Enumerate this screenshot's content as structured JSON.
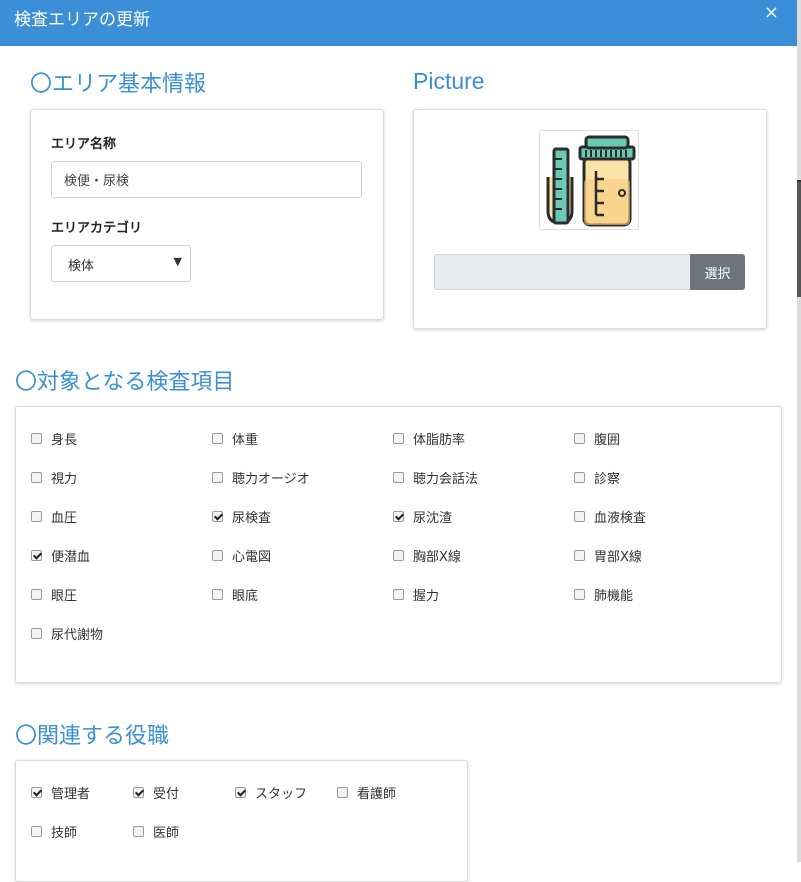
{
  "header": {
    "title": "検査エリアの更新",
    "close_label": "×"
  },
  "area_info": {
    "section_title": "〇エリア基本情報",
    "name_label": "エリア名称",
    "name_value": "検便・尿検",
    "category_label": "エリアカテゴリ",
    "category_value": "検体"
  },
  "picture": {
    "section_title": "Picture",
    "select_button": "選択"
  },
  "exam_items": {
    "section_title": "〇対象となる検査項目",
    "items": [
      {
        "label": "身長",
        "checked": false
      },
      {
        "label": "体重",
        "checked": false
      },
      {
        "label": "体脂肪率",
        "checked": false
      },
      {
        "label": "腹囲",
        "checked": false
      },
      {
        "label": "視力",
        "checked": false
      },
      {
        "label": "聴力オージオ",
        "checked": false
      },
      {
        "label": "聴力会話法",
        "checked": false
      },
      {
        "label": "診察",
        "checked": false
      },
      {
        "label": "血圧",
        "checked": false
      },
      {
        "label": "尿検査",
        "checked": true
      },
      {
        "label": "尿沈渣",
        "checked": true
      },
      {
        "label": "血液検査",
        "checked": false
      },
      {
        "label": "便潜血",
        "checked": true
      },
      {
        "label": "心電図",
        "checked": false
      },
      {
        "label": "胸部X線",
        "checked": false
      },
      {
        "label": "胃部X線",
        "checked": false
      },
      {
        "label": "眼圧",
        "checked": false
      },
      {
        "label": "眼底",
        "checked": false
      },
      {
        "label": "握力",
        "checked": false
      },
      {
        "label": "肺機能",
        "checked": false
      },
      {
        "label": "尿代謝物",
        "checked": false
      }
    ]
  },
  "roles": {
    "section_title": "〇関連する役職",
    "items": [
      {
        "label": "管理者",
        "checked": true
      },
      {
        "label": "受付",
        "checked": true
      },
      {
        "label": "スタッフ",
        "checked": true
      },
      {
        "label": "看護師",
        "checked": false
      },
      {
        "label": "技師",
        "checked": false
      },
      {
        "label": "医師",
        "checked": false
      }
    ]
  },
  "colors": {
    "header": "#3a8fd8",
    "section_title": "#3a8fd8",
    "select_button": "#6c757d"
  }
}
